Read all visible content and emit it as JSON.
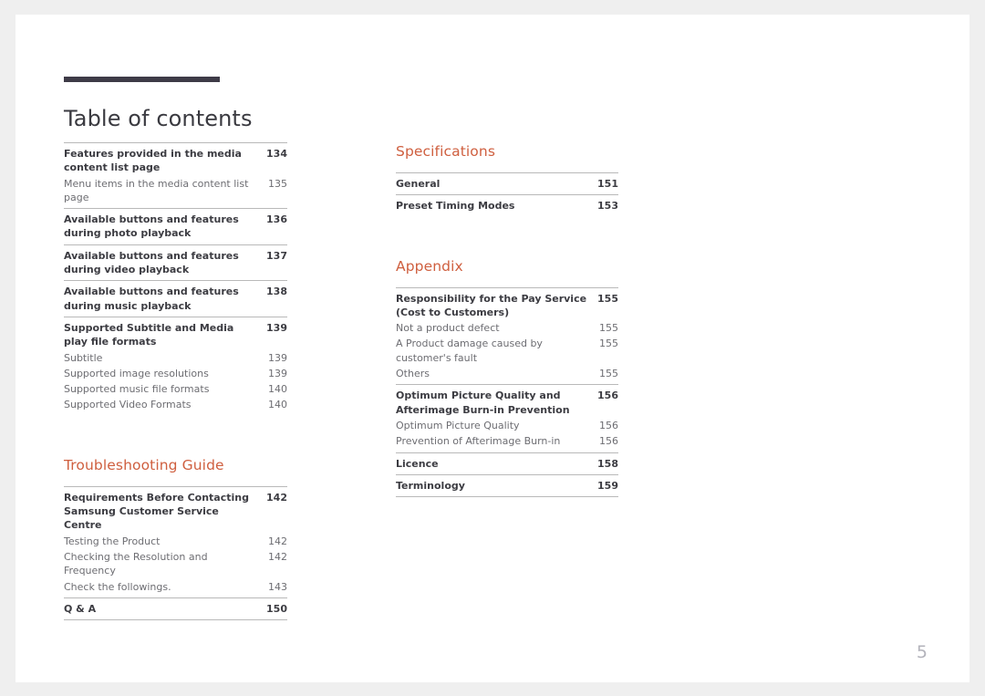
{
  "document": {
    "title": "Table of contents",
    "folio": "5",
    "accent_color": "#cf5f3f",
    "rule_color": "#3e3b47",
    "title_color": "#3a3a40"
  },
  "columns": {
    "left": {
      "blocks": [
        {
          "type": "group",
          "entries": [
            {
              "level": 1,
              "label": "Features provided in the media content list page",
              "page": "134"
            },
            {
              "level": 2,
              "label": "Menu items in the media content list page",
              "page": "135"
            }
          ]
        },
        {
          "type": "group",
          "entries": [
            {
              "level": 1,
              "label": "Available buttons and features during photo playback",
              "page": "136"
            }
          ]
        },
        {
          "type": "group",
          "entries": [
            {
              "level": 1,
              "label": "Available buttons and features during video playback",
              "page": "137"
            }
          ]
        },
        {
          "type": "group",
          "entries": [
            {
              "level": 1,
              "label": "Available buttons and features during music playback",
              "page": "138"
            }
          ]
        },
        {
          "type": "group",
          "entries": [
            {
              "level": 1,
              "label": "Supported Subtitle and Media play file formats",
              "page": "139"
            },
            {
              "level": 2,
              "label": "Subtitle",
              "page": "139"
            },
            {
              "level": 2,
              "label": "Supported image resolutions",
              "page": "139"
            },
            {
              "level": 2,
              "label": "Supported music file formats",
              "page": "140"
            },
            {
              "level": 2,
              "label": "Supported Video Formats",
              "page": "140"
            }
          ]
        },
        {
          "type": "spacer-lg"
        },
        {
          "type": "heading",
          "text": "Troubleshooting Guide"
        },
        {
          "type": "group",
          "entries": [
            {
              "level": 1,
              "label": "Requirements Before Contacting Samsung Customer Service Centre",
              "page": "142"
            },
            {
              "level": 2,
              "label": "Testing the Product",
              "page": "142"
            },
            {
              "level": 2,
              "label": "Checking the Resolution and Frequency",
              "page": "142"
            },
            {
              "level": 2,
              "label": "Check the followings.",
              "page": "143"
            }
          ]
        },
        {
          "type": "group-last",
          "entries": [
            {
              "level": 1,
              "label": "Q & A",
              "page": "150"
            }
          ]
        }
      ]
    },
    "right": {
      "blocks": [
        {
          "type": "heading",
          "text": "Specifications"
        },
        {
          "type": "group",
          "entries": [
            {
              "level": 1,
              "label": "General",
              "page": "151"
            }
          ]
        },
        {
          "type": "group",
          "entries": [
            {
              "level": 1,
              "label": "Preset Timing Modes",
              "page": "153"
            }
          ]
        },
        {
          "type": "spacer-lg"
        },
        {
          "type": "heading",
          "text": "Appendix"
        },
        {
          "type": "group",
          "entries": [
            {
              "level": 1,
              "label": "Responsibility for the Pay Service (Cost to Customers)",
              "page": "155"
            },
            {
              "level": 2,
              "label": "Not a product defect",
              "page": "155"
            },
            {
              "level": 2,
              "label": "A Product damage caused by customer's fault",
              "page": "155"
            },
            {
              "level": 2,
              "label": "Others",
              "page": "155"
            }
          ]
        },
        {
          "type": "group",
          "entries": [
            {
              "level": 1,
              "label": "Optimum Picture Quality and Afterimage Burn-in Prevention",
              "page": "156"
            },
            {
              "level": 2,
              "label": "Optimum Picture Quality",
              "page": "156"
            },
            {
              "level": 2,
              "label": "Prevention of Afterimage Burn-in",
              "page": "156"
            }
          ]
        },
        {
          "type": "group",
          "entries": [
            {
              "level": 1,
              "label": "Licence",
              "page": "158"
            }
          ]
        },
        {
          "type": "group-last",
          "entries": [
            {
              "level": 1,
              "label": "Terminology",
              "page": "159"
            }
          ]
        }
      ]
    }
  }
}
